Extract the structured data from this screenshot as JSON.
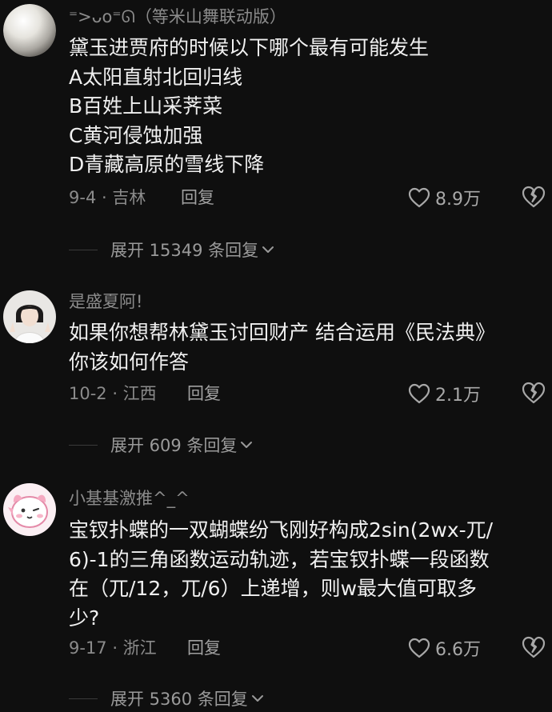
{
  "comments": [
    {
      "username": "⁼>ᴗo⁼ᘏ（等米山舞联动版）",
      "lines": [
        "黛玉进贾府的时候以下哪个最有可能发生",
        "A太阳直射北回归线",
        "B百姓上山采荠菜",
        "C黄河侵蚀加强",
        "D青藏高原的雪线下降"
      ],
      "date_location": "9-4 · 吉林",
      "reply_label": "回复",
      "likes": "8.9万",
      "expand_label": "展开 15349 条回复"
    },
    {
      "username": "是盛夏阿!",
      "lines": [
        "如果你想帮林黛玉讨回财产 结合运用《民法典》",
        "你该如何作答"
      ],
      "date_location": "10-2 · 江西",
      "reply_label": "回复",
      "likes": "2.1万",
      "expand_label": "展开 609 条回复"
    },
    {
      "username": "小基基激推^_^",
      "lines": [
        "宝钗扑蝶的一双蝴蝶纷飞刚好构成2sin(2wx-兀/",
        "6)-1的三角函数运动轨迹，若宝钗扑蝶一段函数",
        "在（兀/12，兀/6）上递增，则w最大值可取多",
        "少?"
      ],
      "date_location": "9-17 · 浙江",
      "reply_label": "回复",
      "likes": "6.6万",
      "expand_label": "展开 5360 条回复"
    }
  ],
  "icons": {
    "like": "heart-outline-icon",
    "dislike": "broken-heart-icon",
    "expand": "chevron-down-icon"
  },
  "colors": {
    "background": "#0f0f0f",
    "primary_text": "#f0f0f0",
    "secondary_text": "#8b8b8b"
  }
}
